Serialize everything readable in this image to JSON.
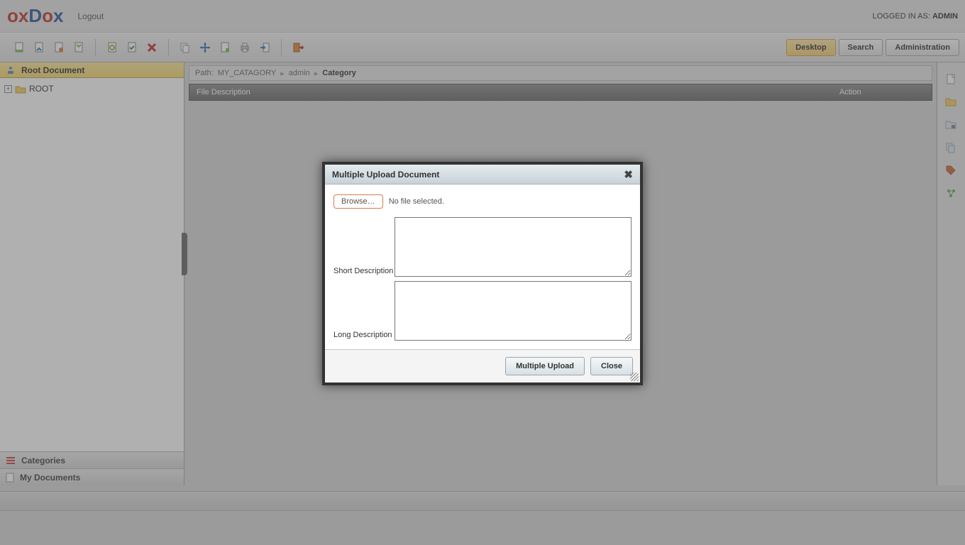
{
  "header": {
    "logo_parts": [
      "ox",
      "D",
      "o",
      "x"
    ],
    "logout": "Logout",
    "logged_in_prefix": "LOGGED IN AS: ",
    "logged_in_user": "ADMIN"
  },
  "toolbar": {
    "buttons": {
      "desktop": "Desktop",
      "search": "Search",
      "administration": "Administration"
    }
  },
  "sidebar": {
    "title": "Root Document",
    "tree_root": "ROOT",
    "accordion": {
      "categories": "Categories",
      "my_documents": "My Documents"
    }
  },
  "content": {
    "breadcrumb": {
      "prefix": "Path:",
      "seg1": "MY_CATAGORY",
      "seg2": "admin",
      "seg3": "Category"
    },
    "grid": {
      "col_file": "File Description",
      "col_action": "Action"
    }
  },
  "dialog": {
    "title": "Multiple Upload Document",
    "browse": "Browse…",
    "no_file": "No file selected.",
    "short_desc_label": "Short Description",
    "long_desc_label": "Long Description",
    "short_desc_value": "",
    "long_desc_value": "",
    "btn_upload": "Multiple Upload",
    "btn_close": "Close"
  }
}
